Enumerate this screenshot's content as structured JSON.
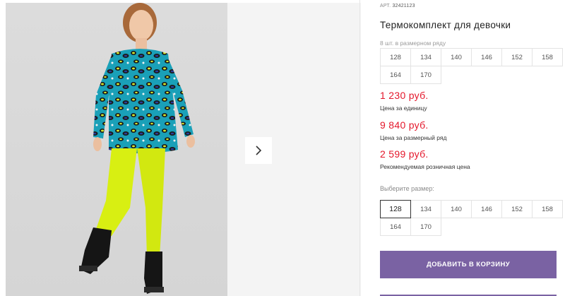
{
  "product": {
    "sku_label": "АРТ.",
    "sku_number": "32421123",
    "title": "Термокомплект для девочки",
    "row_note": "8 шт. в размерном ряду",
    "row_sizes": [
      "128",
      "134",
      "140",
      "146",
      "152",
      "158",
      "164",
      "170"
    ]
  },
  "prices": {
    "unit_price": "1 230 руб.",
    "unit_caption": "Цена за единицу",
    "row_price": "9 840 руб.",
    "row_caption": "Цена за размерный ряд",
    "retail_price": "2 599 руб.",
    "retail_caption": "Рекомендуемая розничная цена"
  },
  "size_select": {
    "label": "Выберите размер:",
    "options": [
      "128",
      "134",
      "140",
      "146",
      "152",
      "158",
      "164",
      "170"
    ],
    "selected": "128"
  },
  "actions": {
    "add_to_cart": "ДОБАВИТЬ В КОРЗИНУ"
  },
  "icons": {
    "next": "chevron-right-icon"
  },
  "colors": {
    "price": "#e4172b",
    "button": "#7a62a3"
  }
}
